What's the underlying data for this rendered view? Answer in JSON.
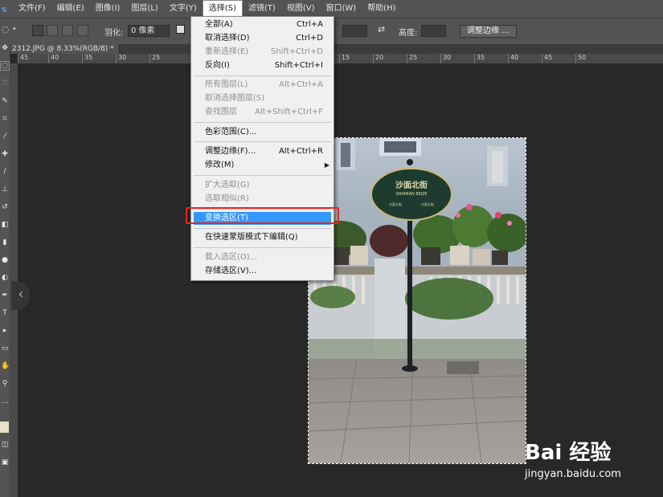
{
  "menubar": {
    "logo": "s",
    "items": [
      "文件(F)",
      "编辑(E)",
      "图像(I)",
      "图层(L)",
      "文字(Y)",
      "选择(S)",
      "滤镜(T)",
      "视图(V)",
      "窗口(W)",
      "帮助(H)"
    ]
  },
  "options": {
    "feather_label": "羽化:",
    "feather_value": "0 像素",
    "height_label": "高度:",
    "adjust_edge_label": "调整边缘 ..."
  },
  "document": {
    "tab_title": "2312.JPG @ 8.33%(RGB/8) *"
  },
  "ruler": {
    "top_labels_left": [
      "45",
      "40",
      "35",
      "30",
      "25"
    ],
    "top_labels_right": [
      "15",
      "20",
      "25",
      "30",
      "35",
      "40",
      "45",
      "50"
    ]
  },
  "select_menu": {
    "items": [
      {
        "label": "全部(A)",
        "shortcut": "Ctrl+A",
        "enabled": true
      },
      {
        "label": "取消选择(D)",
        "shortcut": "Ctrl+D",
        "enabled": true
      },
      {
        "label": "重新选择(E)",
        "shortcut": "Shift+Ctrl+D",
        "enabled": false
      },
      {
        "label": "反向(I)",
        "shortcut": "Shift+Ctrl+I",
        "enabled": true
      },
      {
        "label": "所有图层(L)",
        "shortcut": "Alt+Ctrl+A",
        "enabled": false
      },
      {
        "label": "取消选择图层(S)",
        "shortcut": "",
        "enabled": false
      },
      {
        "label": "查找图层",
        "shortcut": "Alt+Shift+Ctrl+F",
        "enabled": false
      },
      {
        "label": "色彩范围(C)...",
        "shortcut": "",
        "enabled": true
      },
      {
        "label": "调整边缘(F)...",
        "shortcut": "Alt+Ctrl+R",
        "enabled": true
      },
      {
        "label": "修改(M)",
        "shortcut": "",
        "enabled": true,
        "submenu": true
      },
      {
        "label": "扩大选取(G)",
        "shortcut": "",
        "enabled": false
      },
      {
        "label": "选取相似(R)",
        "shortcut": "",
        "enabled": false
      },
      {
        "label": "变换选区(T)",
        "shortcut": "",
        "enabled": true,
        "highlighted": true
      },
      {
        "label": "在快速蒙版模式下编辑(Q)",
        "shortcut": "",
        "enabled": true
      },
      {
        "label": "载入选区(O)...",
        "shortcut": "",
        "enabled": false
      },
      {
        "label": "存储选区(V)...",
        "shortcut": "",
        "enabled": true
      }
    ]
  },
  "photo": {
    "sign_title": "沙面北街",
    "sign_subtitle": "SHAMIAN BEIJIE",
    "sign_small_left": "沙面大街",
    "sign_small_right": "沙面大街"
  },
  "watermark": {
    "brand": "Bai 经验",
    "url": "jingyan.baidu.com"
  },
  "colors": {
    "highlight": "#3399ff",
    "annotation_box": "#e8281f",
    "menubar_bg": "#535353",
    "canvas_bg": "#282828"
  }
}
